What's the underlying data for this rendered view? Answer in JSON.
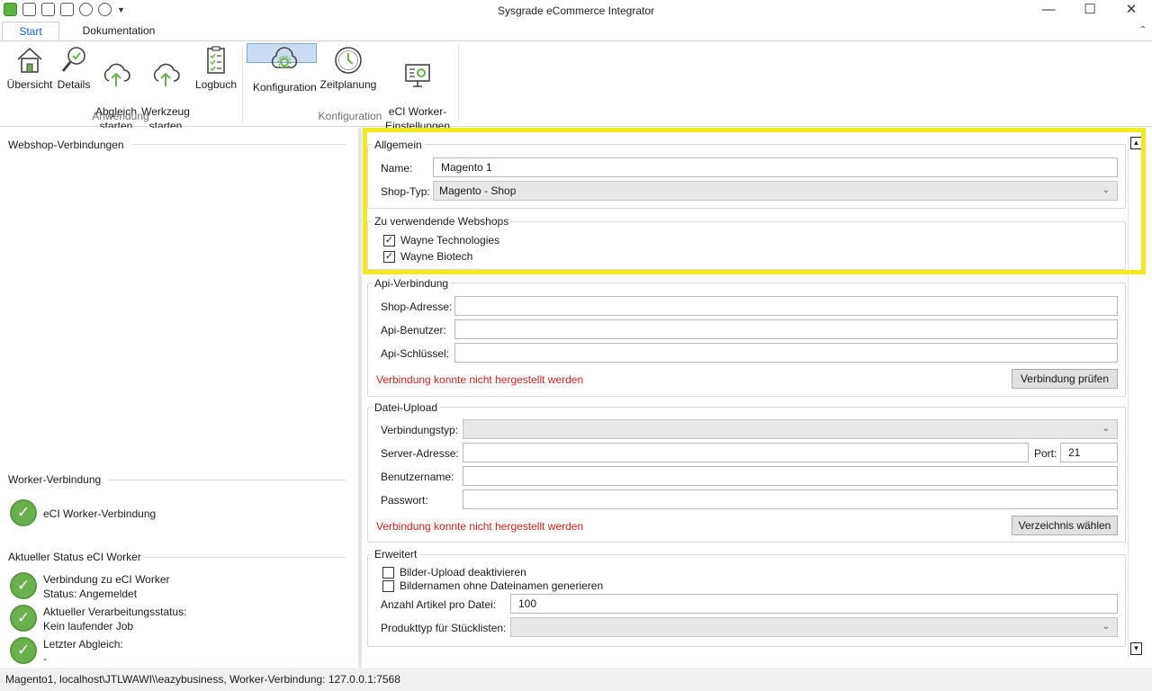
{
  "window": {
    "title": "Sysgrade eCommerce Integrator",
    "minimize": "—",
    "maximize": "☐",
    "close": "✕"
  },
  "ribbon": {
    "tabs": [
      "Start",
      "Dokumentation"
    ],
    "collapse_glyph": "⌃",
    "groups": [
      {
        "label": "Anwendung",
        "buttons": [
          {
            "label": "Übersicht",
            "icon": "house-icon"
          },
          {
            "label": "Details",
            "icon": "magnifier-check-icon"
          },
          {
            "label": "Abgleich\nstarten",
            "icon": "cloud-upload-icon"
          },
          {
            "label": "Werkzeug\nstarten",
            "icon": "cloud-tool-icon"
          },
          {
            "label": "Logbuch",
            "icon": "checklist-icon"
          }
        ]
      },
      {
        "label": "Konfiguration",
        "buttons": [
          {
            "label": "Konfiguration",
            "icon": "cloud-gear-icon",
            "selected": true
          },
          {
            "label": "Zeitplanung",
            "icon": "clock-icon"
          },
          {
            "label": "eCI Worker-\nEinstellungen",
            "icon": "monitor-gear-icon"
          }
        ]
      }
    ]
  },
  "left": {
    "webshop_heading": "Webshop-Verbindungen",
    "worker_heading": "Worker-Verbindung",
    "worker_item": "eCI Worker-Verbindung",
    "status_heading": "Aktueller Status eCI Worker",
    "status_items": [
      {
        "line1": "Verbindung zu eCI Worker",
        "line2": "Status: Angemeldet"
      },
      {
        "line1": "Aktueller Verarbeitungsstatus:",
        "line2": "Kein laufender Job"
      },
      {
        "line1": "Letzter Abgleich:",
        "line2": "-"
      }
    ]
  },
  "allgemein": {
    "title": "Allgemein",
    "name_label": "Name:",
    "name_value": "Magento 1",
    "shoptyp_label": "Shop-Typ:",
    "shoptyp_value": "Magento - Shop"
  },
  "webshops": {
    "title": "Zu verwendende Webshops",
    "items": [
      {
        "label": "Wayne Technologies",
        "checked": true
      },
      {
        "label": "Wayne Biotech",
        "checked": true
      }
    ]
  },
  "api": {
    "title": "Api-Verbindung",
    "shop_label": "Shop-Adresse:",
    "shop_value": "",
    "user_label": "Api-Benutzer:",
    "user_value": "",
    "key_label": "Api-Schlüssel:",
    "key_value": "",
    "error": "Verbindung konnte nicht hergestellt werden",
    "test_button": "Verbindung prüfen"
  },
  "upload": {
    "title": "Datei-Upload",
    "type_label": "Verbindungstyp:",
    "type_value": "",
    "server_label": "Server-Adresse:",
    "server_value": "",
    "port_label": "Port:",
    "port_value": "21",
    "user_label": "Benutzername:",
    "user_value": "",
    "pass_label": "Passwort:",
    "pass_value": "",
    "error": "Verbindung konnte nicht hergestellt werden",
    "dir_button": "Verzeichnis wählen"
  },
  "advanced": {
    "title": "Erweitert",
    "cb1": "Bilder-Upload deaktivieren",
    "cb2": "Bildernamen ohne Dateinamen generieren",
    "count_label": "Anzahl Artikel pro Datei:",
    "count_value": "100",
    "type_label": "Produkttyp für Stücklisten:",
    "type_value": ""
  },
  "statusbar": "Magento1, localhost\\JTLWAWI\\\\eazybusiness, Worker-Verbindung: 127.0.0.1:7568",
  "colors": {
    "accent": "#1e5fa8",
    "highlight": "#f2ea1a",
    "error": "#d42020",
    "ok_green": "#6ab04c"
  }
}
